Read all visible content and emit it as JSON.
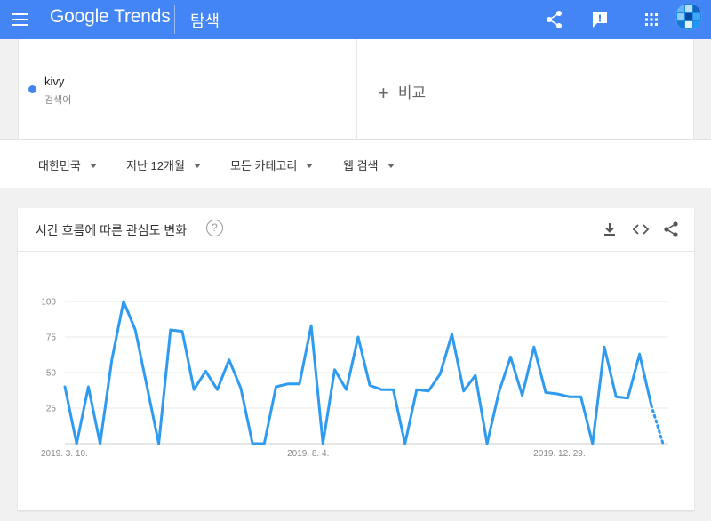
{
  "header": {
    "logo_google": "Google",
    "logo_trends": "Trends",
    "page_title": "탐색",
    "icons": [
      "menu-icon",
      "share-icon",
      "feedback-icon",
      "apps-grid-icon",
      "account-avatar"
    ],
    "background_color": "#4385f5"
  },
  "search": {
    "term": "kivy",
    "term_type": "검색어",
    "term_color": "#4285f4",
    "compare_label": "비교"
  },
  "filters": {
    "region": "대한민국",
    "period": "지난 12개월",
    "category": "모든 카테고리",
    "property": "웹 검색"
  },
  "card": {
    "title": "시간 흐름에 따른 관심도 변화",
    "help_glyph": "?",
    "icons": [
      "download-icon",
      "embed-icon",
      "share-icon"
    ]
  },
  "chart_data": {
    "type": "line",
    "title": "",
    "xlabel": "",
    "ylabel": "",
    "ylim": [
      0,
      100
    ],
    "y_ticks": [
      100,
      75,
      50,
      25
    ],
    "grid": true,
    "x_ticks": [
      {
        "label": "2019. 3. 10.",
        "index": 0
      },
      {
        "label": "2019. 8. 4.",
        "index": 21
      },
      {
        "label": "2019. 12. 29.",
        "index": 42
      }
    ],
    "series": [
      {
        "color": "#2f9bf0",
        "values": [
          40,
          0,
          40,
          0,
          59,
          100,
          80,
          40,
          0,
          80,
          79,
          38,
          51,
          38,
          59,
          39,
          0,
          0,
          40,
          42,
          42,
          83,
          0,
          52,
          38,
          75,
          41,
          38,
          38,
          0,
          38,
          37,
          49,
          77,
          37,
          48,
          0,
          36,
          61,
          34,
          68,
          36,
          35,
          33,
          33,
          0,
          68,
          33,
          32,
          63,
          27,
          0
        ],
        "partial_from_index": 50
      }
    ]
  }
}
